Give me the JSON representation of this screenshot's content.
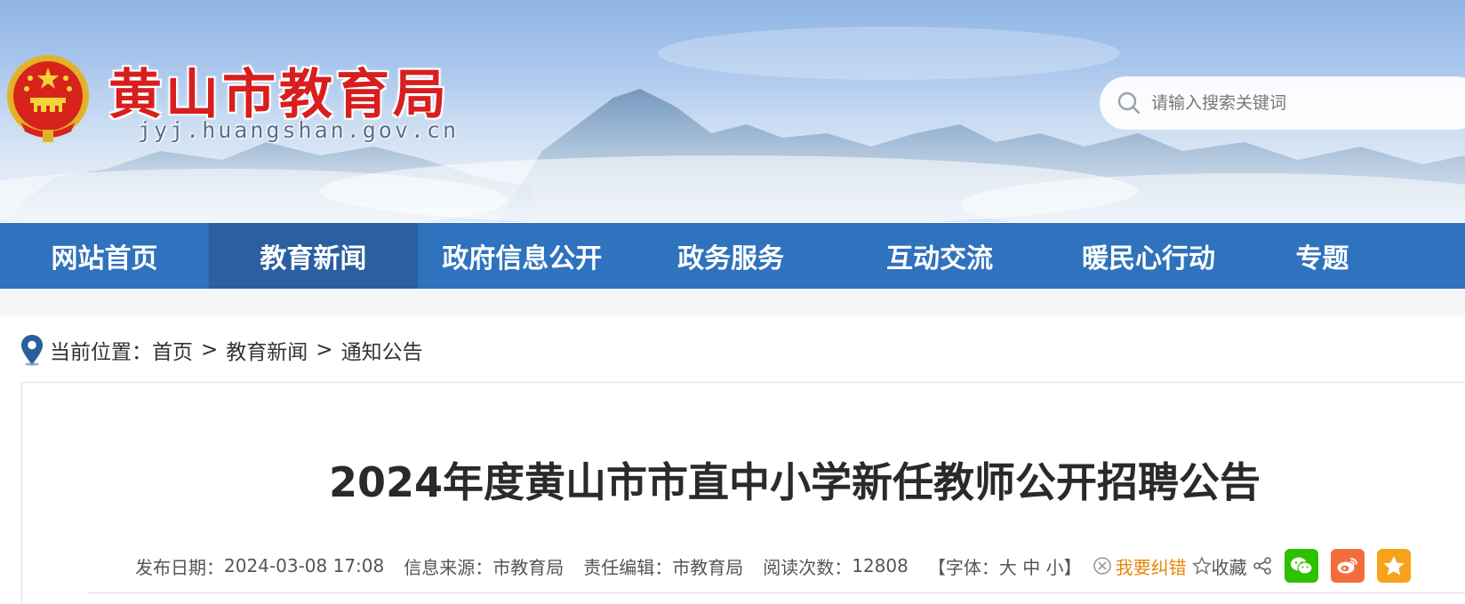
{
  "header": {
    "title": "黄山市教育局",
    "domain": "jyj.huangshan.gov.cn",
    "search_placeholder": "请输入搜索关键词"
  },
  "nav": {
    "items": [
      "网站首页",
      "教育新闻",
      "政府信息公开",
      "政务服务",
      "互动交流",
      "暖民心行动",
      "专题"
    ],
    "active": "教育新闻"
  },
  "breadcrumb": {
    "label": "当前位置：",
    "items": [
      "首页",
      "教育新闻",
      "通知公告"
    ],
    "separator": ">"
  },
  "article": {
    "title": "2024年度黄山市市直中小学新任教师公开招聘公告",
    "publish_label": "发布日期：",
    "publish_date": "2024-03-08 17:08",
    "source_label": "信息来源：",
    "source": "市教育局",
    "editor_label": "责任编辑：",
    "editor": "市教育局",
    "views_label": "阅读次数：",
    "views": "12808",
    "font_label_open": "【字体：",
    "font_large": "大",
    "font_medium": "中",
    "font_small": "小",
    "font_label_close": "】",
    "correct_label": "我要纠错",
    "favorite_label": "收藏"
  },
  "colors": {
    "nav_bg": "#2f72bd",
    "nav_active": "#2b5f9f",
    "title_red": "#d81e1e",
    "correct_orange": "#e8860c",
    "wechat_green": "#2dc100",
    "weibo_orange": "#f26d3d",
    "star_orange": "#f7a21b"
  },
  "icons": [
    "national-emblem-icon",
    "search-icon",
    "location-pin-icon",
    "close-circle-icon",
    "star-icon",
    "share-icon",
    "wechat-icon",
    "weibo-icon",
    "qzone-icon"
  ]
}
